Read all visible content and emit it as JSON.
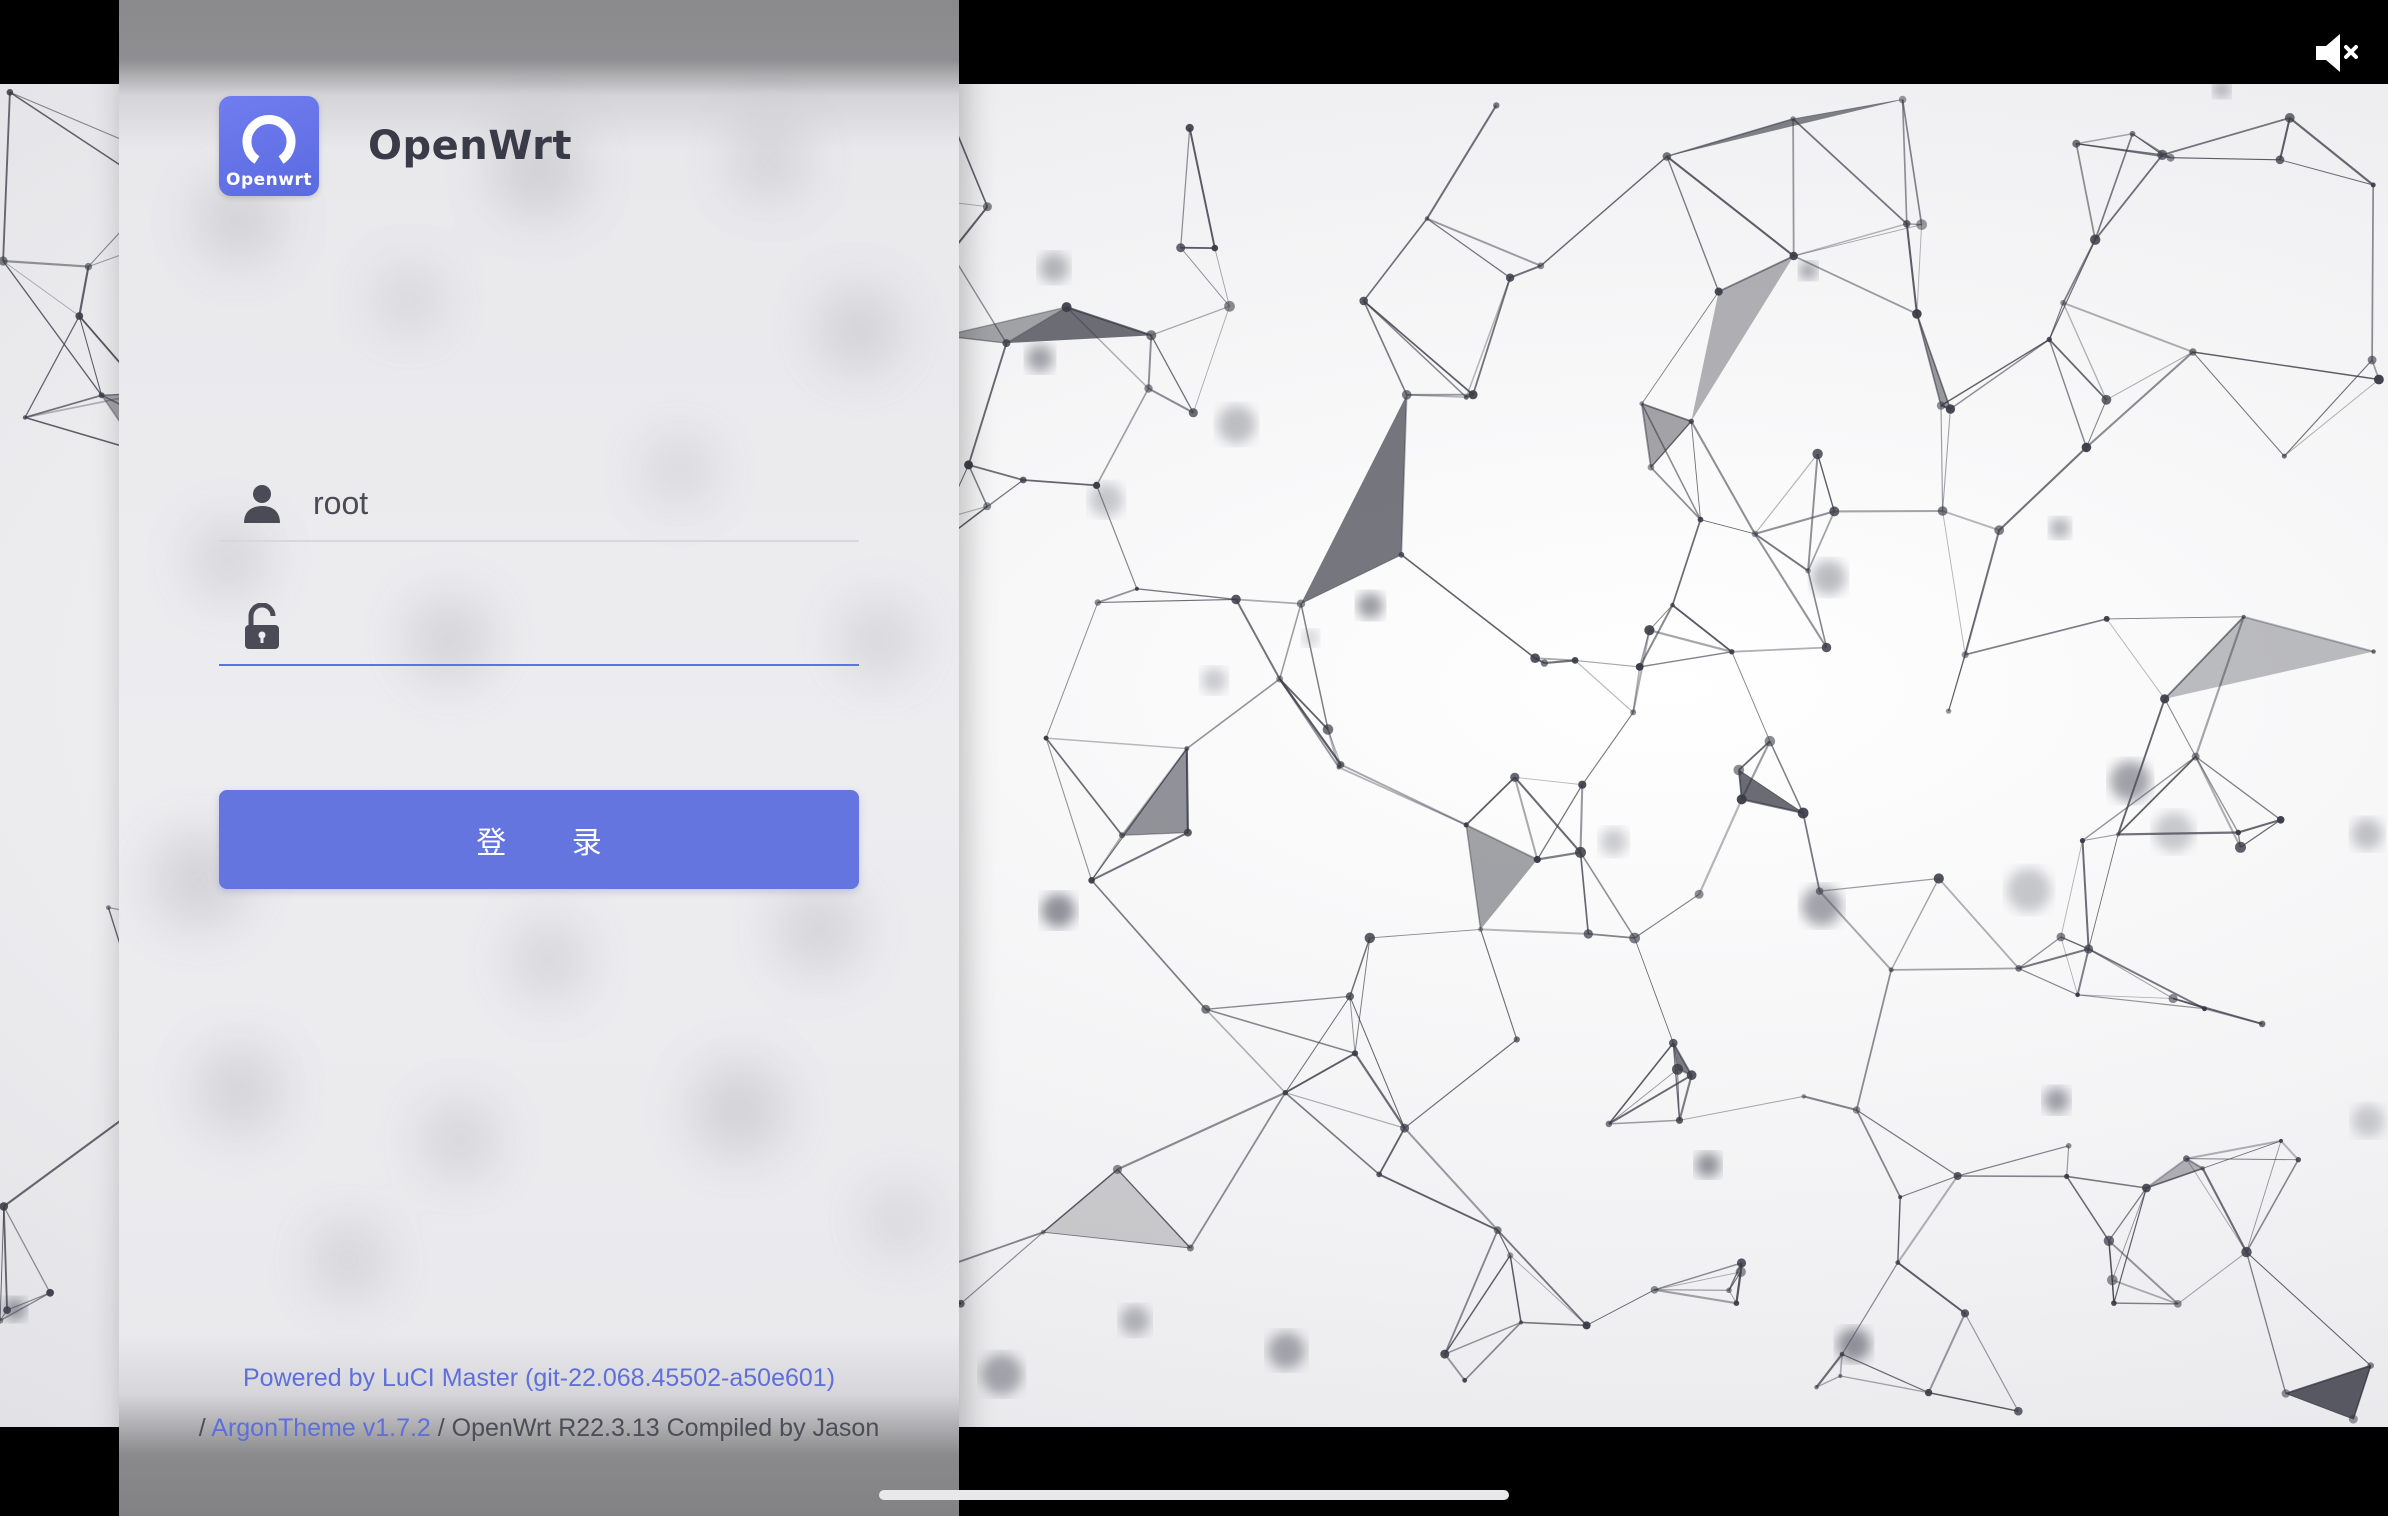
{
  "brand": {
    "logo_label": "Openwrt",
    "name": "OpenWrt"
  },
  "login": {
    "username_value": "root",
    "password_value": "",
    "submit_label": "登 录"
  },
  "footer": {
    "powered_by": "Powered by LuCI Master (git-22.068.45502-a50e601)",
    "separator_1": "/ ",
    "theme_link": "ArgonTheme v1.7.2",
    "build_info": " / OpenWrt R22.3.13 Compiled by Jason"
  },
  "icons": {
    "mute": "speaker-muted-icon",
    "user": "user-icon",
    "lock": "unlock-icon"
  },
  "colors": {
    "accent": "#5e72e4",
    "button": "#6475e0",
    "logo": "#6473e6"
  }
}
